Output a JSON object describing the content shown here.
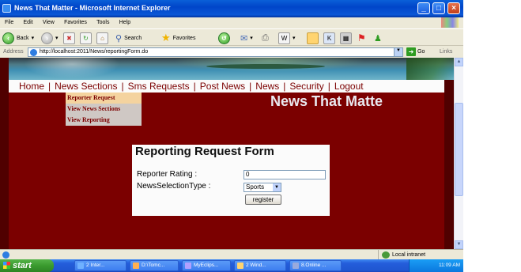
{
  "window": {
    "title": "News That Matter - Microsoft Internet Explorer",
    "controls": [
      "_",
      "□",
      "×"
    ]
  },
  "menubar": {
    "items": [
      "File",
      "Edit",
      "View",
      "Favorites",
      "Tools",
      "Help"
    ]
  },
  "toolbar": {
    "back": "Back",
    "search": "Search",
    "favorites": "Favorites"
  },
  "addressbar": {
    "label": "Address",
    "url": "http://localhost:2011/News/reportingForm.do",
    "go": "Go",
    "links": "Links"
  },
  "page": {
    "nav": [
      "Home",
      "News Sections",
      "Sms Requests",
      "Post News",
      "News",
      "Security",
      "Logout"
    ],
    "submenu": [
      "Reporter Request",
      "View News Sections",
      "View Reporting"
    ],
    "site_title": "News That Matte",
    "form": {
      "heading": "Reporting Request Form",
      "rating_label": "Reporter Rating :",
      "rating_value": "0",
      "type_label": "NewsSelectionType :",
      "type_value": "Sports",
      "submit_label": "register"
    }
  },
  "statusbar": {
    "zone": "Local intranet"
  },
  "taskbar": {
    "start": "start",
    "tasks": [
      "2 Inter...",
      "D:\\Tomc...",
      "MyEclips...",
      "2 Wind...",
      "8.Online ..."
    ],
    "clock": "11:09 AM"
  },
  "colors": {
    "page_background": "#7b0000",
    "nav_text": "#7b0000",
    "submenu_active": "#f4d39f",
    "xp_titlebar": "#0a57d6"
  }
}
